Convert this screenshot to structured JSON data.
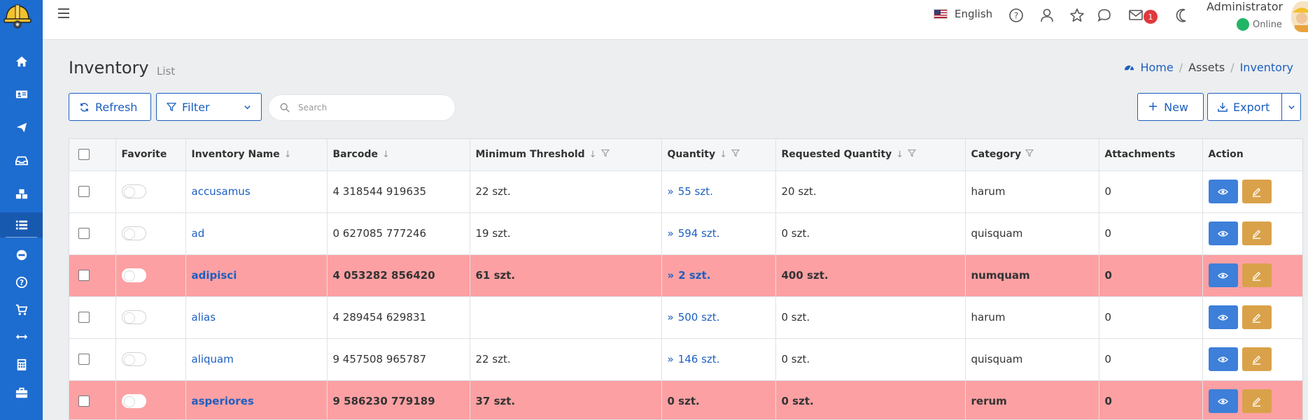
{
  "topbar": {
    "language": "English",
    "mail_count": "1",
    "user_name": "Administrator",
    "user_status": "Online"
  },
  "page": {
    "title": "Inventory",
    "subtitle": "List"
  },
  "breadcrumb": [
    "Home",
    "Assets",
    "Inventory"
  ],
  "toolbar": {
    "refresh_label": "Refresh",
    "filter_label": "Filter",
    "search_placeholder": "Search",
    "new_label": "New",
    "export_label": "Export"
  },
  "table": {
    "headers": [
      "Favorite",
      "Inventory Name",
      "Barcode",
      "Minimum Threshold",
      "Quantity",
      "Requested Quantity",
      "Category",
      "Attachments",
      "Action"
    ],
    "rows": [
      {
        "name": "accusamus",
        "barcode": "4 318544 919635",
        "threshold": "22 szt.",
        "quantity": "55 szt.",
        "requested": "20 szt.",
        "category": "harum",
        "attachments": "0",
        "alert": false,
        "qty_link": true
      },
      {
        "name": "ad",
        "barcode": "0 627085 777246",
        "threshold": "19 szt.",
        "quantity": "594 szt.",
        "requested": "0 szt.",
        "category": "quisquam",
        "attachments": "0",
        "alert": false,
        "qty_link": true
      },
      {
        "name": "adipisci",
        "barcode": "4 053282 856420",
        "threshold": "61 szt.",
        "quantity": "2 szt.",
        "requested": "400 szt.",
        "category": "numquam",
        "attachments": "0",
        "alert": true,
        "qty_link": true
      },
      {
        "name": "alias",
        "barcode": "4 289454 629831",
        "threshold": "",
        "quantity": "500 szt.",
        "requested": "0 szt.",
        "category": "harum",
        "attachments": "0",
        "alert": false,
        "qty_link": true
      },
      {
        "name": "aliquam",
        "barcode": "9 457508 965787",
        "threshold": "22 szt.",
        "quantity": "146 szt.",
        "requested": "0 szt.",
        "category": "quisquam",
        "attachments": "0",
        "alert": false,
        "qty_link": true
      },
      {
        "name": "asperiores",
        "barcode": "9 586230 779189",
        "threshold": "37 szt.",
        "quantity": "0 szt.",
        "requested": "0 szt.",
        "category": "rerum",
        "attachments": "0",
        "alert": true,
        "qty_link": false
      }
    ]
  },
  "colors": {
    "sidebar": "#1d6ccf",
    "accent": "#1d5fc0",
    "alert_row": "#fca0a3",
    "view_button": "#3d7fd9",
    "edit_button": "#d9a24a",
    "online": "#21b568"
  }
}
